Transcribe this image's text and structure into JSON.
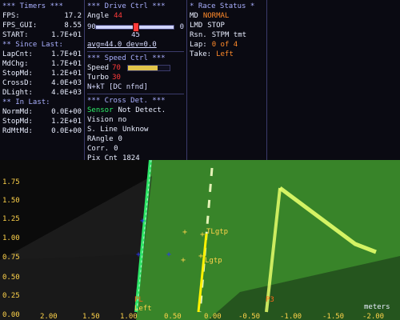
{
  "colors": {
    "panel_bg": "#0a0a12",
    "accent_text": "#aab0ff",
    "orange": "#ff8a2a",
    "red": "#ff3a3a",
    "gold": "#e1c44a",
    "green": "#2ef06a",
    "camera_green": "#3b8b2b"
  },
  "timers": {
    "title": "*** Timers ***",
    "fps_label": "FPS:",
    "fps_value": "17.2",
    "fps_gui_label": "FPS_GUI:",
    "fps_gui_value": "8.55",
    "start_label": "START:",
    "start_value": "1.7E+01",
    "since_last_title": "** Since Last:",
    "since_last": [
      {
        "label": "LapCnt:",
        "value": "1.7E+01"
      },
      {
        "label": "MdChg:",
        "value": "1.7E+01"
      },
      {
        "label": "StopMd:",
        "value": "1.2E+01"
      },
      {
        "label": "CrossD:",
        "value": "4.0E+03"
      },
      {
        "label": "DLight:",
        "value": "4.0E+03"
      }
    ],
    "in_last_title": "** In Last:",
    "in_last": [
      {
        "label": "NormMd:",
        "value": "0.0E+00"
      },
      {
        "label": "StopMd:",
        "value": "1.2E+01"
      },
      {
        "label": "RdMtMd:",
        "value": "0.0E+00"
      }
    ]
  },
  "drive_ctrl": {
    "title": "***  Drive Ctrl  ***",
    "angle_label": "Angle",
    "angle_value": "44",
    "slider_min": "90",
    "slider_max": "0",
    "slider_value_label": "45",
    "slider_fraction": 0.51,
    "avg_dev": "avg=44.0  dev=0.0",
    "speed_title": "***  Speed Ctrl  ***",
    "speed_label": "Speed",
    "speed_value": "70",
    "speed_fraction": 0.72,
    "turbo_label": "Turbo",
    "turbo_value": "30",
    "nk_line": "N+kT  [DC nfnd]",
    "cross_title": "***  Cross Det.  ***",
    "cross_rows": [
      {
        "label": "Sensor",
        "value": "Not Detect."
      },
      {
        "label": "Vision",
        "value": "no"
      },
      {
        "label": "S. Line",
        "value": "Unknow"
      },
      {
        "label": "RAngle",
        "value": "0"
      },
      {
        "label": "Corr.",
        "value": "0"
      },
      {
        "label": "Pix Cnt",
        "value": "1824"
      }
    ]
  },
  "race_status": {
    "title": "*  Race Status  *",
    "rows": [
      {
        "label": "MD",
        "value": "NORMAL"
      },
      {
        "label": "LMD",
        "value": "STOP"
      },
      {
        "label": "Rsn.",
        "value": "STPM tmt"
      },
      {
        "label": "Lap:",
        "value": "0 of 4"
      },
      {
        "label": "Take:",
        "value": "Left"
      }
    ]
  },
  "camera": {
    "units_label": "meters",
    "y_ticks": [
      "1.75",
      "1.50",
      "1.25",
      "1.00",
      "0.75",
      "0.50",
      "0.25",
      "0.00"
    ],
    "x_ticks": [
      "2.00",
      "1.50",
      "1.00",
      "0.50",
      "0.00",
      "-0.50",
      "-1.00",
      "-1.50",
      "-2.00"
    ],
    "labels": {
      "tl": "TLgtp",
      "l": "Lgtp",
      "left": "Left",
      "pl": "PL",
      "p3": "P3"
    }
  }
}
